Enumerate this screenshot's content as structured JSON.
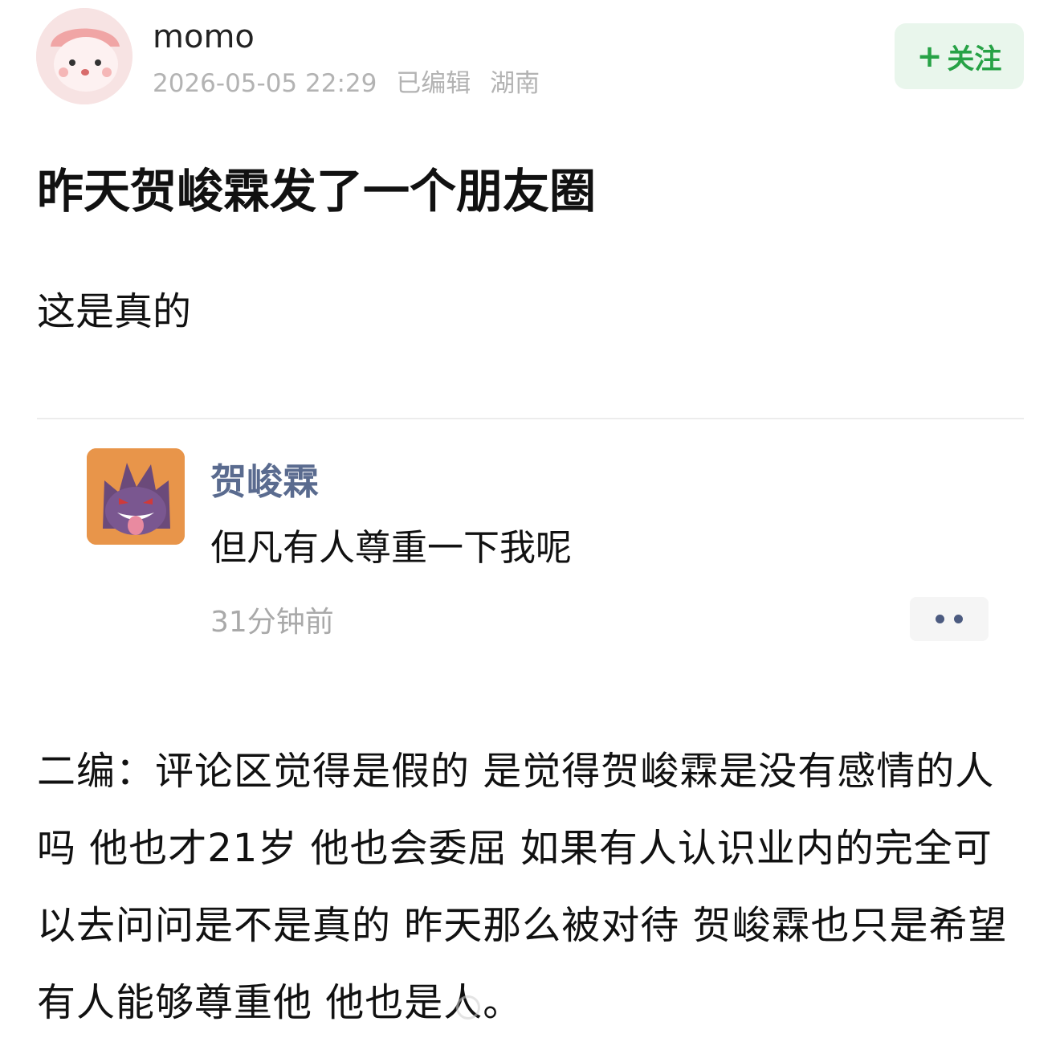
{
  "post": {
    "author": {
      "name": "momo",
      "date": "2026-05-05 22:29",
      "edited": "已编辑",
      "location": "湖南"
    },
    "follow_button": {
      "plus": "+",
      "label": "关注"
    },
    "title": "昨天贺峻霖发了一个朋友圈",
    "lead": "这是真的",
    "quoted_moment": {
      "name": "贺峻霖",
      "text": "但凡有人尊重一下我呢",
      "time": "31分钟前"
    },
    "edit_note": "二编：评论区觉得是假的 是觉得贺峻霖是没有感情的人吗 他也才21岁 他也会委屈 如果有人认识业内的完全可以去问问是不是真的 昨天那么被对待 贺峻霖也只是希望有人能够尊重他 他也是人。"
  },
  "colors": {
    "follow_bg": "#e9f6ec",
    "follow_text": "#27a246",
    "moment_name": "#5a6b8f"
  }
}
